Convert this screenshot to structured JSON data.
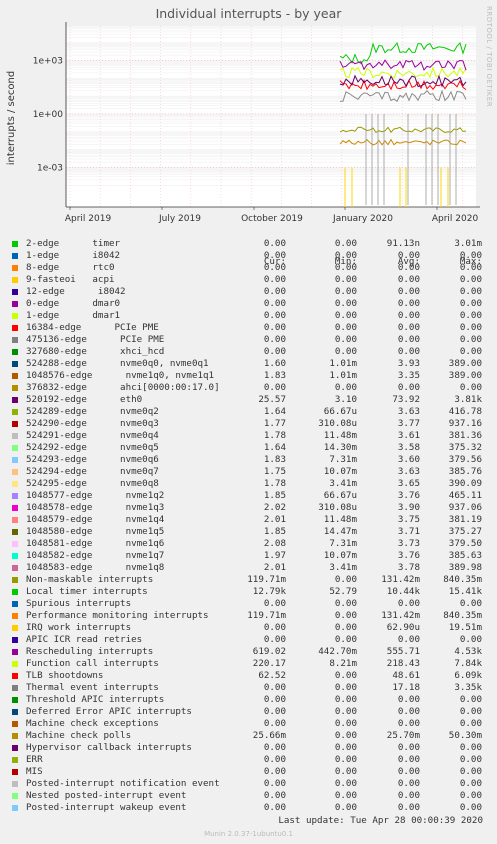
{
  "title": "Individual interrupts - by year",
  "side_label": "RRDTOOL / TOBI OETIKER",
  "ylabel": "interrupts / second",
  "footer": "Munin 2.0.37-1ubuntu0.1",
  "last_update": "Last update: Tue Apr 28 00:00:39 2020",
  "headers": {
    "cur": "Cur:",
    "min": "Min:",
    "avg": "Avg:",
    "max": "Max:"
  },
  "chart_data": {
    "type": "line",
    "title": "Individual interrupts - by year",
    "ylabel": "interrupts / second",
    "y_scale": "log",
    "y_ticks": [
      "1e-03",
      "1e+00",
      "1e+03"
    ],
    "x_ticks": [
      "April 2019",
      "July 2019",
      "October 2019",
      "January 2020",
      "April 2020"
    ],
    "data_start": "December 2019",
    "series": [
      {
        "name": "Local timer interrupts",
        "color": "#00cc00",
        "approx_level": 5000
      },
      {
        "name": "Function call interrupts",
        "color": "#ccff00",
        "approx_level": 200
      },
      {
        "name": "Rescheduling interrupts",
        "color": "#990099",
        "approx_level": 550
      },
      {
        "name": "TLB shootdowns",
        "color": "#ff0000",
        "approx_level": 40
      },
      {
        "name": "Thermal event interrupts",
        "color": "#888888",
        "approx_level": 10
      },
      {
        "name": "Non-maskable interrupts",
        "color": "#999900",
        "approx_level": 0.13
      },
      {
        "name": "Machine check polls",
        "color": "#cc8800",
        "approx_level": 0.026
      },
      {
        "name": "520192-edge eth0",
        "color": "#660066",
        "approx_level": 70
      }
    ]
  },
  "legend": [
    {
      "color": "#00cc00",
      "label": "2-edge      timer",
      "cur": "0.00",
      "min": "0.00",
      "avg": "91.13n",
      "max": "3.01m"
    },
    {
      "color": "#0066b3",
      "label": "1-edge      i8042",
      "cur": "0.00",
      "min": "0.00",
      "avg": "0.00",
      "max": "0.00"
    },
    {
      "color": "#ff8000",
      "label": "8-edge      rtc0",
      "cur": "0.00",
      "min": "0.00",
      "avg": "0.00",
      "max": "0.00"
    },
    {
      "color": "#ffcc00",
      "label": "9-fasteoi   acpi",
      "cur": "0.00",
      "min": "0.00",
      "avg": "0.00",
      "max": "0.00"
    },
    {
      "color": "#330099",
      "label": "12-edge      i8042",
      "cur": "0.00",
      "min": "0.00",
      "avg": "0.00",
      "max": "0.00"
    },
    {
      "color": "#990099",
      "label": "0-edge      dmar0",
      "cur": "0.00",
      "min": "0.00",
      "avg": "0.00",
      "max": "0.00"
    },
    {
      "color": "#ccff00",
      "label": "1-edge      dmar1",
      "cur": "0.00",
      "min": "0.00",
      "avg": "0.00",
      "max": "0.00"
    },
    {
      "color": "#ff0000",
      "label": "16384-edge      PCIe PME",
      "cur": "0.00",
      "min": "0.00",
      "avg": "0.00",
      "max": "0.00"
    },
    {
      "color": "#808080",
      "label": "475136-edge      PCIe PME",
      "cur": "0.00",
      "min": "0.00",
      "avg": "0.00",
      "max": "0.00"
    },
    {
      "color": "#008f00",
      "label": "327680-edge      xhci_hcd",
      "cur": "0.00",
      "min": "0.00",
      "avg": "0.00",
      "max": "0.00"
    },
    {
      "color": "#00487d",
      "label": "524288-edge      nvme0q0, nvme0q1",
      "cur": "1.60",
      "min": "1.01m",
      "avg": "3.93",
      "max": "389.00"
    },
    {
      "color": "#b35a00",
      "label": "1048576-edge      nvme1q0, nvme1q1",
      "cur": "1.83",
      "min": "1.01m",
      "avg": "3.35",
      "max": "389.00"
    },
    {
      "color": "#b38f00",
      "label": "376832-edge      ahci[0000:00:17.0]",
      "cur": "0.00",
      "min": "0.00",
      "avg": "0.00",
      "max": "0.00"
    },
    {
      "color": "#6b006b",
      "label": "520192-edge      eth0",
      "cur": "25.57",
      "min": "3.10",
      "avg": "73.92",
      "max": "3.81k"
    },
    {
      "color": "#8fb300",
      "label": "524289-edge      nvme0q2",
      "cur": "1.64",
      "min": "66.67u",
      "avg": "3.63",
      "max": "416.78"
    },
    {
      "color": "#b30000",
      "label": "524290-edge      nvme0q3",
      "cur": "1.77",
      "min": "310.08u",
      "avg": "3.77",
      "max": "937.16"
    },
    {
      "color": "#bebebe",
      "label": "524291-edge      nvme0q4",
      "cur": "1.78",
      "min": "11.48m",
      "avg": "3.61",
      "max": "381.36"
    },
    {
      "color": "#80ff80",
      "label": "524292-edge      nvme0q5",
      "cur": "1.64",
      "min": "14.30m",
      "avg": "3.58",
      "max": "375.32"
    },
    {
      "color": "#80c9ff",
      "label": "524293-edge      nvme0q6",
      "cur": "1.83",
      "min": "7.31m",
      "avg": "3.60",
      "max": "379.56"
    },
    {
      "color": "#ffc080",
      "label": "524294-edge      nvme0q7",
      "cur": "1.75",
      "min": "10.07m",
      "avg": "3.63",
      "max": "385.76"
    },
    {
      "color": "#ffe680",
      "label": "524295-edge      nvme0q8",
      "cur": "1.78",
      "min": "3.41m",
      "avg": "3.65",
      "max": "390.09"
    },
    {
      "color": "#aa80ff",
      "label": "1048577-edge      nvme1q2",
      "cur": "1.85",
      "min": "66.67u",
      "avg": "3.76",
      "max": "465.11"
    },
    {
      "color": "#ee00cc",
      "label": "1048578-edge      nvme1q3",
      "cur": "2.02",
      "min": "310.08u",
      "avg": "3.90",
      "max": "937.06"
    },
    {
      "color": "#ff8080",
      "label": "1048579-edge      nvme1q4",
      "cur": "2.01",
      "min": "11.48m",
      "avg": "3.75",
      "max": "381.19"
    },
    {
      "color": "#666600",
      "label": "1048580-edge      nvme1q5",
      "cur": "1.85",
      "min": "14.47m",
      "avg": "3.71",
      "max": "375.27"
    },
    {
      "color": "#ffbfff",
      "label": "1048581-edge      nvme1q6",
      "cur": "2.08",
      "min": "7.31m",
      "avg": "3.73",
      "max": "379.50"
    },
    {
      "color": "#00ffcc",
      "label": "1048582-edge      nvme1q7",
      "cur": "1.97",
      "min": "10.07m",
      "avg": "3.76",
      "max": "385.63"
    },
    {
      "color": "#cc6699",
      "label": "1048583-edge      nvme1q8",
      "cur": "2.01",
      "min": "3.41m",
      "avg": "3.78",
      "max": "389.98"
    },
    {
      "color": "#999900",
      "label": "Non-maskable interrupts",
      "cur": "119.71m",
      "min": "0.00",
      "avg": "131.42m",
      "max": "840.35m"
    },
    {
      "color": "#00cc00",
      "label": "Local timer interrupts",
      "cur": "12.79k",
      "min": "52.79",
      "avg": "10.44k",
      "max": "15.41k"
    },
    {
      "color": "#0066b3",
      "label": "Spurious interrupts",
      "cur": "0.00",
      "min": "0.00",
      "avg": "0.00",
      "max": "0.00"
    },
    {
      "color": "#ff8000",
      "label": "Performance monitoring interrupts",
      "cur": "119.71m",
      "min": "0.00",
      "avg": "131.42m",
      "max": "840.35m"
    },
    {
      "color": "#ffcc00",
      "label": "IRQ work interrupts",
      "cur": "0.00",
      "min": "0.00",
      "avg": "62.90u",
      "max": "19.51m"
    },
    {
      "color": "#330099",
      "label": "APIC ICR read retries",
      "cur": "0.00",
      "min": "0.00",
      "avg": "0.00",
      "max": "0.00"
    },
    {
      "color": "#990099",
      "label": "Rescheduling interrupts",
      "cur": "619.02",
      "min": "442.70m",
      "avg": "555.71",
      "max": "4.53k"
    },
    {
      "color": "#ccff00",
      "label": "Function call interrupts",
      "cur": "220.17",
      "min": "8.21m",
      "avg": "218.43",
      "max": "7.84k"
    },
    {
      "color": "#ff0000",
      "label": "TLB shootdowns",
      "cur": "62.52",
      "min": "0.00",
      "avg": "48.61",
      "max": "6.09k"
    },
    {
      "color": "#808080",
      "label": "Thermal event interrupts",
      "cur": "0.00",
      "min": "0.00",
      "avg": "17.18",
      "max": "3.35k"
    },
    {
      "color": "#008f00",
      "label": "Threshold APIC interrupts",
      "cur": "0.00",
      "min": "0.00",
      "avg": "0.00",
      "max": "0.00"
    },
    {
      "color": "#00487d",
      "label": "Deferred Error APIC interrupts",
      "cur": "0.00",
      "min": "0.00",
      "avg": "0.00",
      "max": "0.00"
    },
    {
      "color": "#b35a00",
      "label": "Machine check exceptions",
      "cur": "0.00",
      "min": "0.00",
      "avg": "0.00",
      "max": "0.00"
    },
    {
      "color": "#b38f00",
      "label": "Machine check polls",
      "cur": "25.66m",
      "min": "0.00",
      "avg": "25.70m",
      "max": "50.30m"
    },
    {
      "color": "#6b006b",
      "label": "Hypervisor callback interrupts",
      "cur": "0.00",
      "min": "0.00",
      "avg": "0.00",
      "max": "0.00"
    },
    {
      "color": "#8fb300",
      "label": "ERR",
      "cur": "0.00",
      "min": "0.00",
      "avg": "0.00",
      "max": "0.00"
    },
    {
      "color": "#b30000",
      "label": "MIS",
      "cur": "0.00",
      "min": "0.00",
      "avg": "0.00",
      "max": "0.00"
    },
    {
      "color": "#bebebe",
      "label": "Posted-interrupt notification event",
      "cur": "0.00",
      "min": "0.00",
      "avg": "0.00",
      "max": "0.00"
    },
    {
      "color": "#80ff80",
      "label": "Nested posted-interrupt event",
      "cur": "0.00",
      "min": "0.00",
      "avg": "0.00",
      "max": "0.00"
    },
    {
      "color": "#80c9ff",
      "label": "Posted-interrupt wakeup event",
      "cur": "0.00",
      "min": "0.00",
      "avg": "0.00",
      "max": "0.00"
    }
  ]
}
